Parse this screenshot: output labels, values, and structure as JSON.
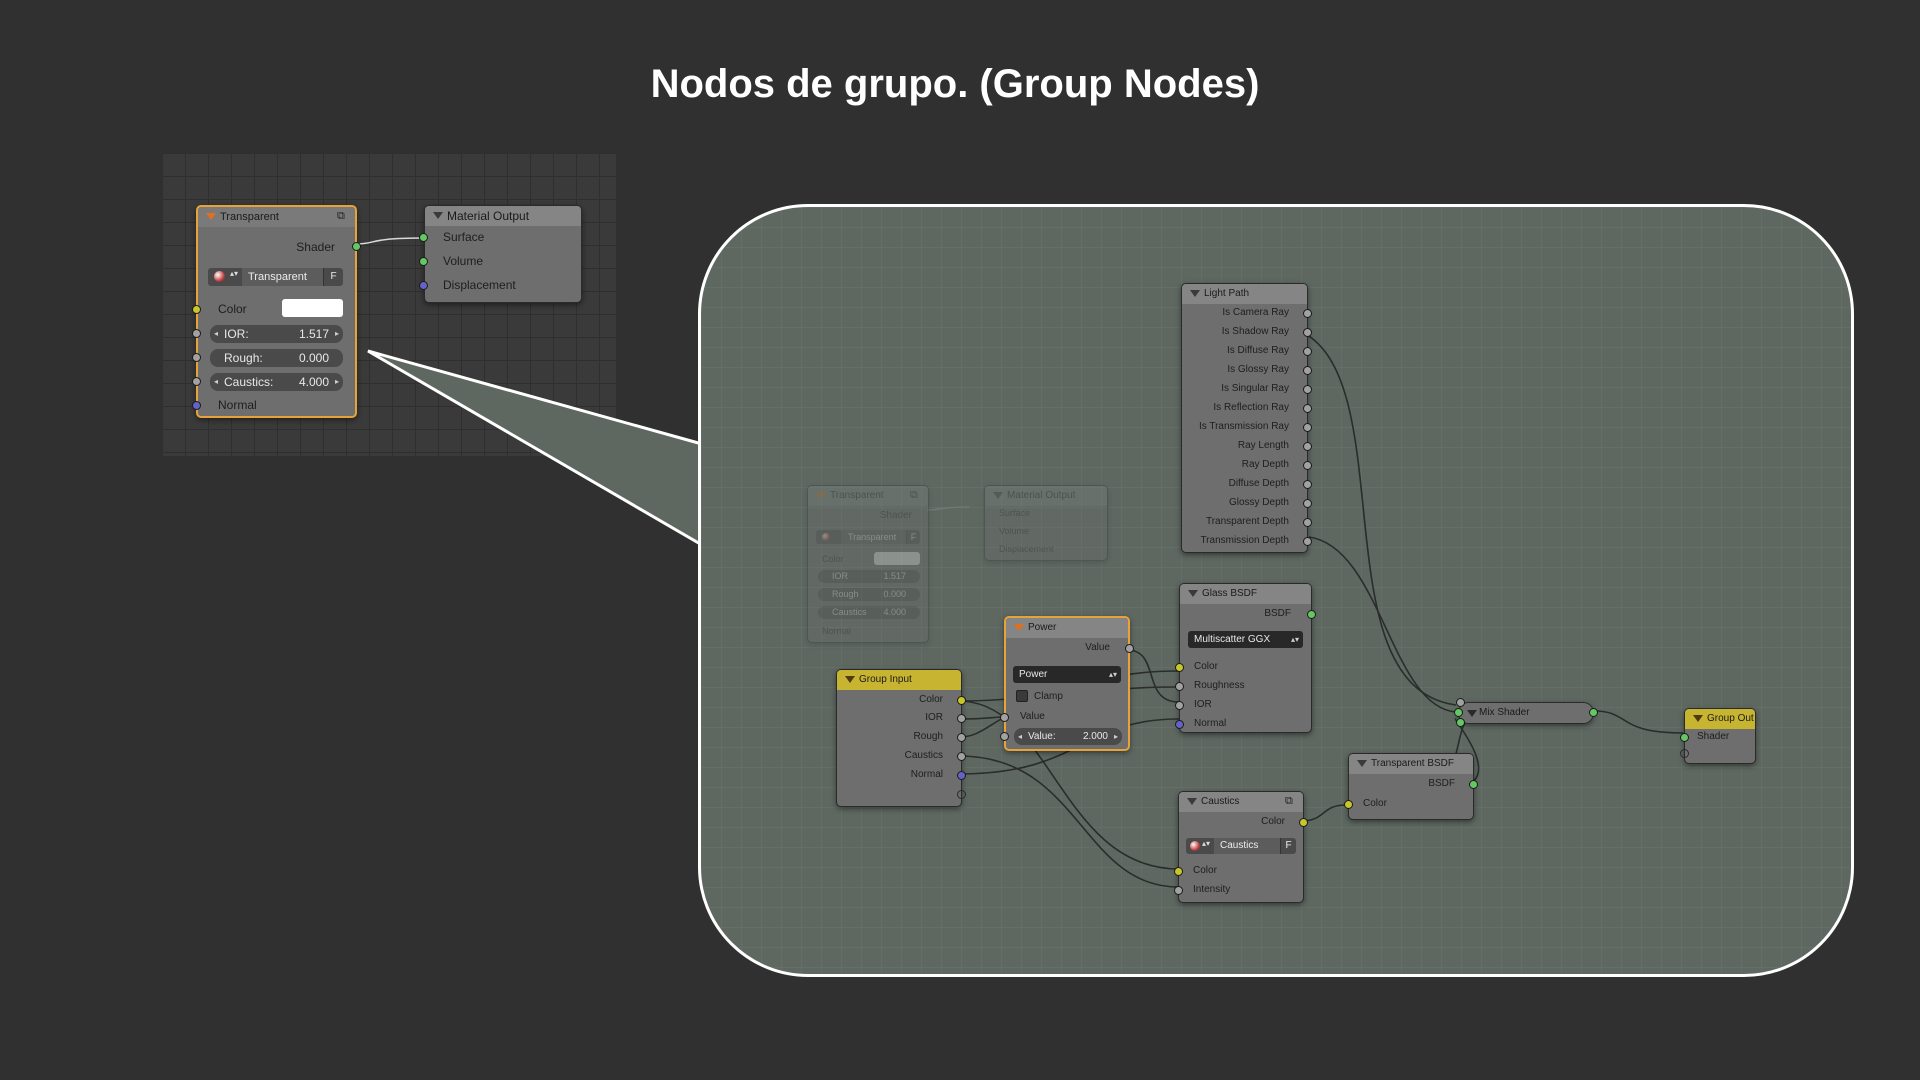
{
  "slide": {
    "title": "Nodos de grupo. (Group Nodes)"
  },
  "small_editor": {
    "transparent_node": {
      "title": "Transparent",
      "output_shader": "Shader",
      "picker_name": "Transparent",
      "picker_f": "F",
      "color_label": "Color",
      "ior_label": "IOR:",
      "ior_value": "1.517",
      "rough_label": "Rough:",
      "rough_value": "0.000",
      "caustics_label": "Caustics:",
      "caustics_value": "4.000",
      "normal_label": "Normal"
    },
    "material_output_node": {
      "title": "Material Output",
      "surface": "Surface",
      "volume": "Volume",
      "displacement": "Displacement"
    }
  },
  "group_editor": {
    "light_path": {
      "title": "Light Path",
      "outputs": [
        "Is Camera Ray",
        "Is Shadow Ray",
        "Is Diffuse Ray",
        "Is Glossy Ray",
        "Is Singular Ray",
        "Is Reflection Ray",
        "Is Transmission Ray",
        "Ray Length",
        "Ray Depth",
        "Diffuse Depth",
        "Glossy Depth",
        "Transparent Depth",
        "Transmission Depth"
      ]
    },
    "glass_bsdf": {
      "title": "Glass BSDF",
      "output": "BSDF",
      "distribution": "Multiscatter GGX",
      "color": "Color",
      "roughness": "Roughness",
      "ior": "IOR",
      "normal": "Normal"
    },
    "power": {
      "title": "Power",
      "output": "Value",
      "operation": "Power",
      "clamp": "Clamp",
      "value_in": "Value",
      "value_label": "Value:",
      "value_value": "2.000"
    },
    "group_input": {
      "title": "Group Input",
      "outputs": [
        "Color",
        "IOR",
        "Rough",
        "Caustics",
        "Normal"
      ]
    },
    "caustics": {
      "title": "Caustics",
      "output": "Color",
      "picker_name": "Caustics",
      "picker_f": "F",
      "color_in": "Color",
      "intensity_in": "Intensity"
    },
    "transparent_bsdf": {
      "title": "Transparent BSDF",
      "output": "BSDF",
      "color_in": "Color"
    },
    "mix_shader": {
      "title": "Mix Shader"
    },
    "group_out": {
      "title": "Group Out",
      "shader": "Shader"
    },
    "ghost_transparent": {
      "title": "Transparent",
      "shader": "Shader",
      "picker_name": "Transparent",
      "picker_f": "F",
      "color": "Color",
      "ior_label": "IOR",
      "ior_value": "1.517",
      "rough_label": "Rough",
      "rough_value": "0.000",
      "caustics_label": "Caustics",
      "caustics_value": "4.000",
      "normal": "Normal"
    },
    "ghost_material_output": {
      "title": "Material Output",
      "surface": "Surface",
      "volume": "Volume",
      "displacement": "Displacement"
    }
  },
  "colors": {
    "background": "#303030",
    "callout_fill": "#5e6861",
    "socket_shader": "#63c763",
    "socket_color": "#c7c729",
    "socket_value": "#a1a1a1",
    "socket_vector": "#6363c7",
    "active_border": "#e8a23a",
    "group_header": "#c7b431"
  }
}
